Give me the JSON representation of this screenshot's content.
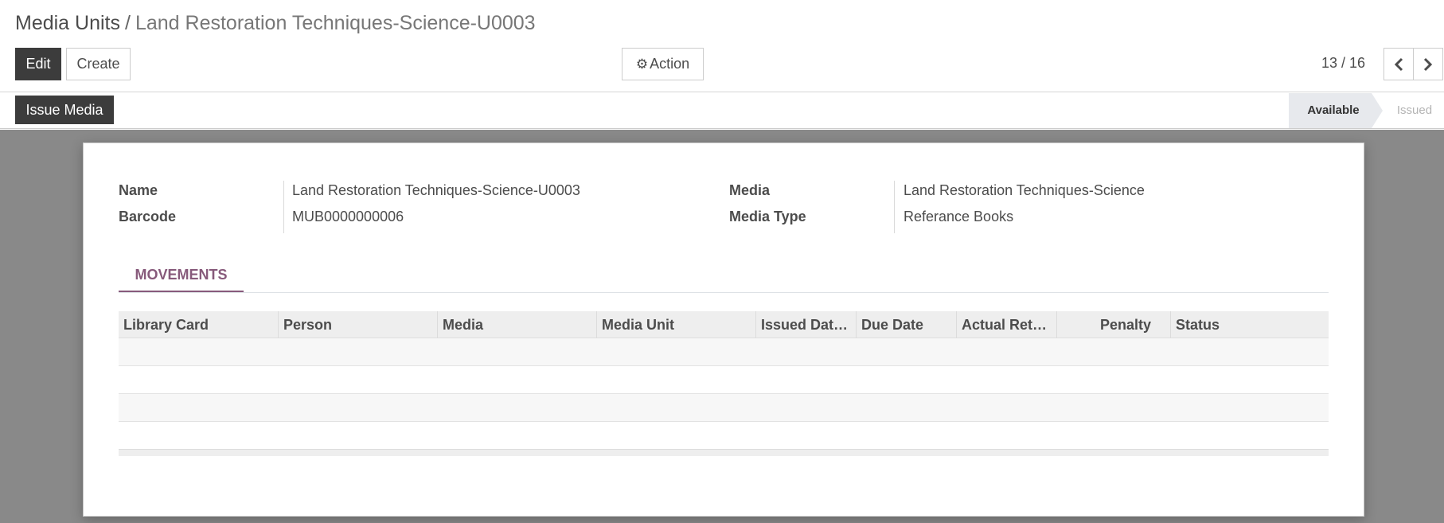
{
  "breadcrumb": {
    "parent": "Media Units",
    "separator": "/",
    "current": "Land Restoration Techniques-Science-U0003"
  },
  "toolbar": {
    "edit_label": "Edit",
    "create_label": "Create",
    "action_label": "Action",
    "action_icon": "gear-icon"
  },
  "pager": {
    "value": "13 / 16",
    "prev_icon": "chevron-left-icon",
    "next_icon": "chevron-right-icon"
  },
  "statusbar": {
    "issue_label": "Issue Media",
    "stages": [
      "Available",
      "Issued"
    ],
    "active_stage": "Available"
  },
  "form": {
    "name_label": "Name",
    "name_value": "Land Restoration Techniques-Science-U0003",
    "barcode_label": "Barcode",
    "barcode_value": "MUB0000000006",
    "media_label": "Media",
    "media_value": "Land Restoration Techniques-Science",
    "media_type_label": "Media Type",
    "media_type_value": "Referance Books"
  },
  "tabs": [
    {
      "label": "MOVEMENTS",
      "active": true
    }
  ],
  "movements": {
    "columns": [
      "Library Card",
      "Person",
      "Media",
      "Media Unit",
      "Issued Dat…",
      "Due Date",
      "Actual Ret…",
      "Penalty",
      "Status"
    ],
    "rows": []
  },
  "colors": {
    "accent": "#875a7b",
    "dark_button": "#3c3c3c",
    "backdrop": "#898989",
    "stage_active_bg": "#e7e9ed"
  }
}
